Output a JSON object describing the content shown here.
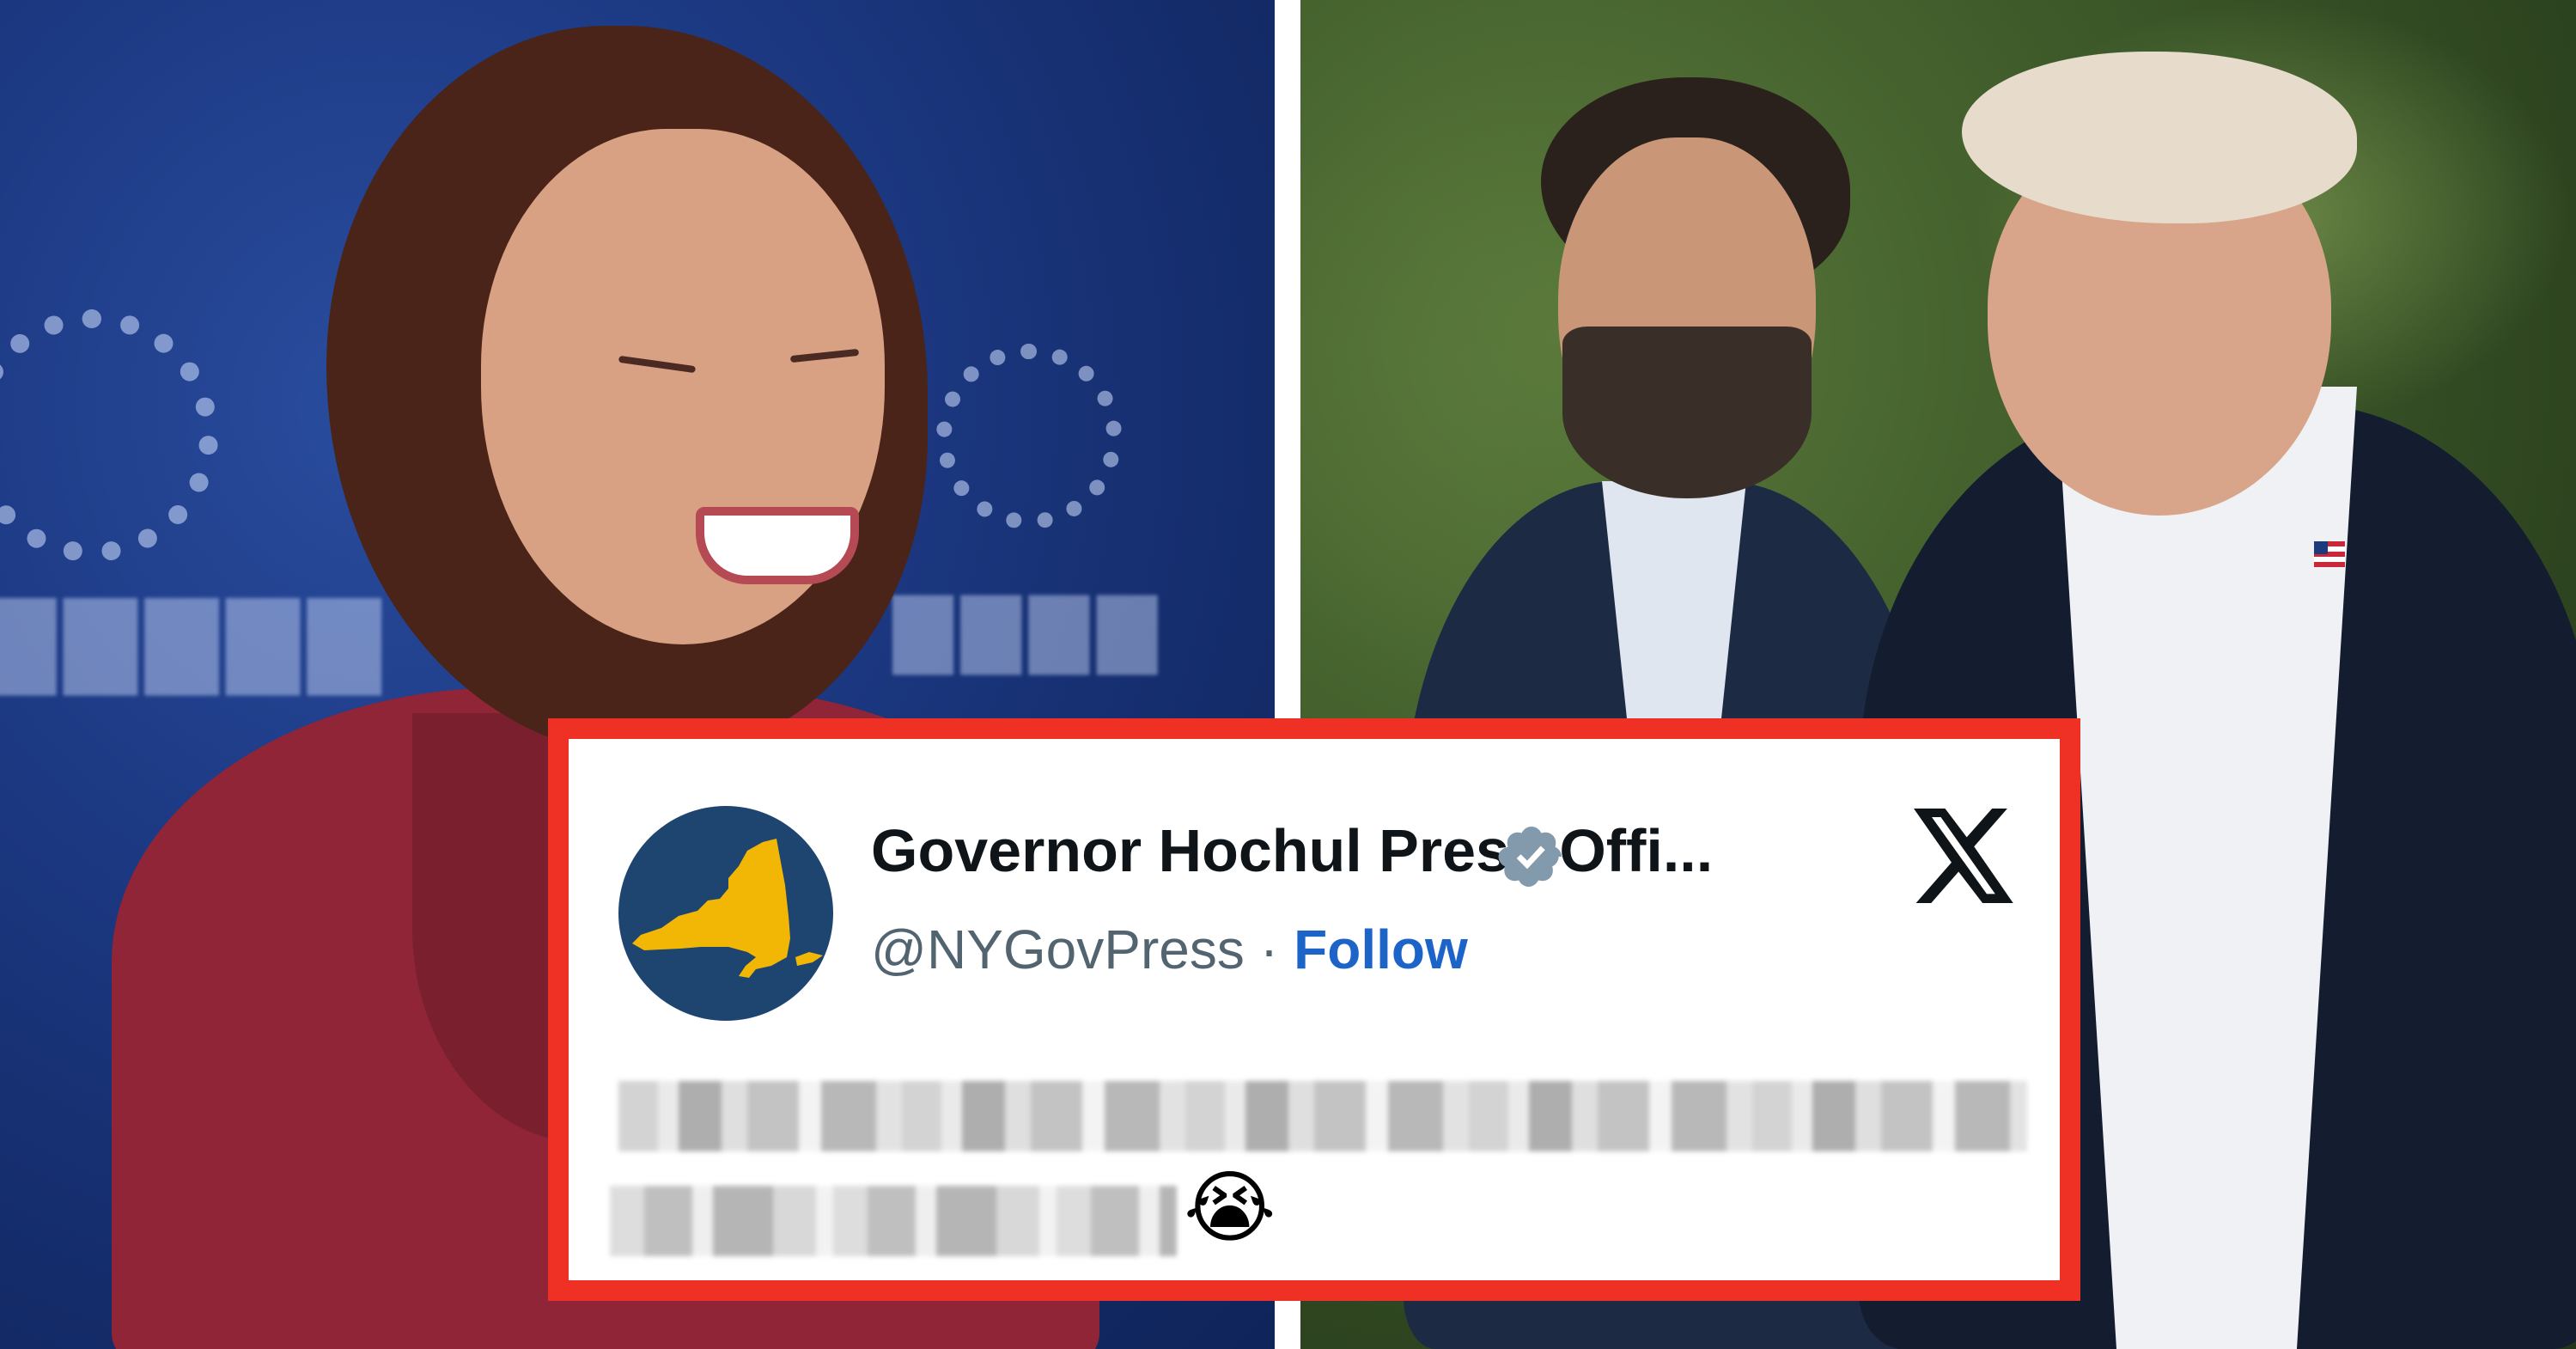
{
  "tweet": {
    "display_name": "Governor Hochul Press Offi...",
    "handle": "@NYGovPress",
    "separator": "·",
    "follow_label": "Follow",
    "emoji": "😭",
    "avatar_icon": "new-york-state-map-icon",
    "platform_icon": "x-logo-icon",
    "verified_icon": "verified-badge-icon"
  },
  "colors": {
    "frame_accent": "#ee3124",
    "follow_link": "#1d64c9",
    "avatar_background": "#1d4570",
    "state_map": "#f2b705",
    "verified_badge": "#829aab",
    "left_photo_background": "#1d3a85",
    "right_photo_background": "#3e5a2a"
  }
}
